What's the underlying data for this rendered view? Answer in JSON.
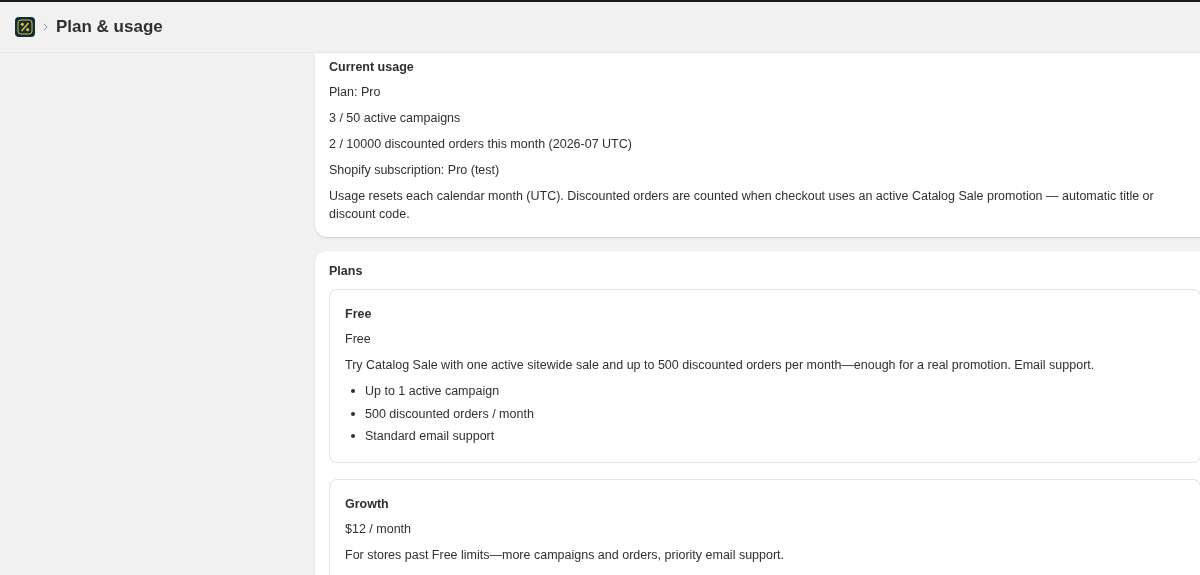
{
  "header": {
    "title": "Plan & usage"
  },
  "usage": {
    "title": "Current usage",
    "lines": [
      "Plan: Pro",
      "3 / 50 active campaigns",
      "2 / 10000 discounted orders this month (2026-07 UTC)",
      "Shopify subscription: Pro (test)",
      "Usage resets each calendar month (UTC). Discounted orders are counted when checkout uses an active Catalog Sale promotion — automatic title or discount code."
    ]
  },
  "plans": {
    "title": "Plans",
    "items": [
      {
        "name": "Free",
        "price": "Free",
        "description": "Try Catalog Sale with one active sitewide sale and up to 500 discounted orders per month—enough for a real promotion. Email support.",
        "features": [
          "Up to 1 active campaign",
          "500 discounted orders / month",
          "Standard email support"
        ]
      },
      {
        "name": "Growth",
        "price": "$12 / month",
        "description": "For stores past Free limits—more campaigns and orders, priority email support."
      }
    ]
  }
}
